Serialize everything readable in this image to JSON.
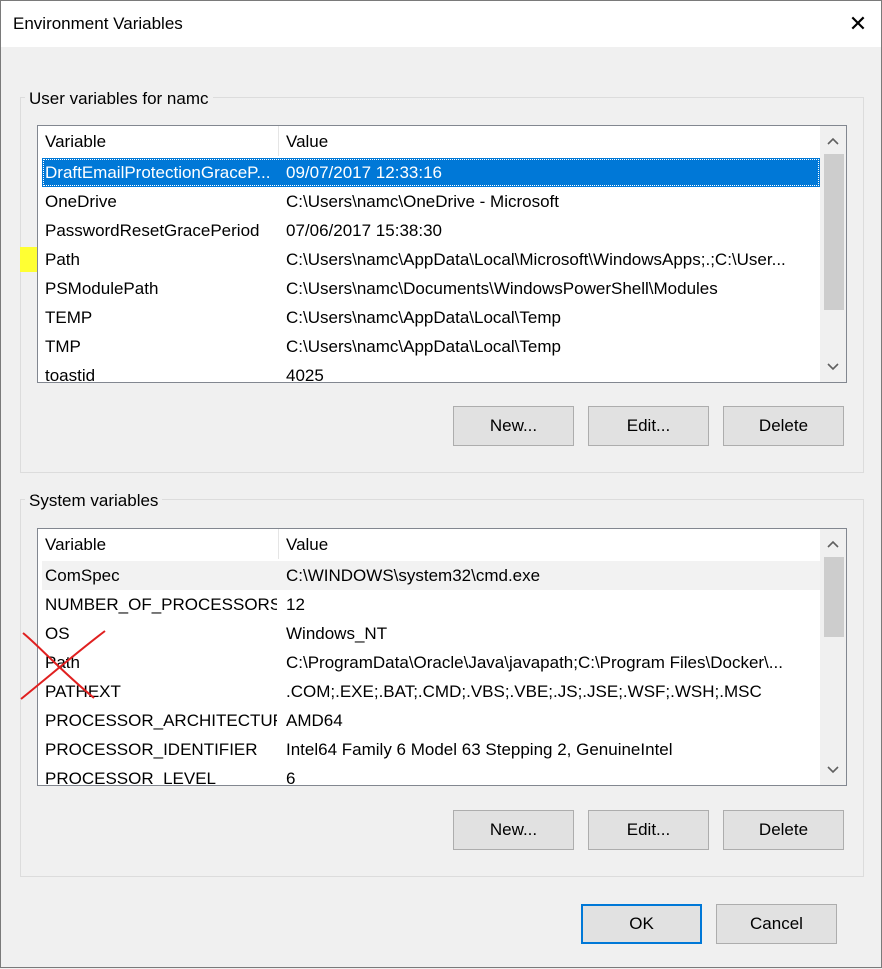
{
  "window": {
    "title": "Environment Variables"
  },
  "user_vars": {
    "label": "User variables for namc",
    "columns": [
      "Variable",
      "Value"
    ],
    "rows": [
      {
        "name": "DraftEmailProtectionGraceP...",
        "value": "09/07/2017 12:33:16"
      },
      {
        "name": "OneDrive",
        "value": "C:\\Users\\namc\\OneDrive - Microsoft"
      },
      {
        "name": "PasswordResetGracePeriod",
        "value": "07/06/2017 15:38:30"
      },
      {
        "name": "Path",
        "value": "C:\\Users\\namc\\AppData\\Local\\Microsoft\\WindowsApps;.;C:\\User..."
      },
      {
        "name": "PSModulePath",
        "value": "C:\\Users\\namc\\Documents\\WindowsPowerShell\\Modules"
      },
      {
        "name": "TEMP",
        "value": "C:\\Users\\namc\\AppData\\Local\\Temp"
      },
      {
        "name": "TMP",
        "value": "C:\\Users\\namc\\AppData\\Local\\Temp"
      },
      {
        "name": "toastid",
        "value": "4025"
      }
    ],
    "buttons": {
      "new": "New...",
      "edit": "Edit...",
      "delete": "Delete"
    }
  },
  "system_vars": {
    "label": "System variables",
    "columns": [
      "Variable",
      "Value"
    ],
    "rows": [
      {
        "name": "ComSpec",
        "value": "C:\\WINDOWS\\system32\\cmd.exe"
      },
      {
        "name": "NUMBER_OF_PROCESSORS",
        "value": "12"
      },
      {
        "name": "OS",
        "value": "Windows_NT"
      },
      {
        "name": "Path",
        "value": "C:\\ProgramData\\Oracle\\Java\\javapath;C:\\Program Files\\Docker\\..."
      },
      {
        "name": "PATHEXT",
        "value": ".COM;.EXE;.BAT;.CMD;.VBS;.VBE;.JS;.JSE;.WSF;.WSH;.MSC"
      },
      {
        "name": "PROCESSOR_ARCHITECTURE",
        "value": "AMD64"
      },
      {
        "name": "PROCESSOR_IDENTIFIER",
        "value": "Intel64 Family 6 Model 63 Stepping 2, GenuineIntel"
      },
      {
        "name": "PROCESSOR_LEVEL",
        "value": "6"
      }
    ],
    "buttons": {
      "new": "New...",
      "edit": "Edit...",
      "delete": "Delete"
    }
  },
  "footer": {
    "ok": "OK",
    "cancel": "Cancel"
  },
  "colors": {
    "selection": "#0078d7",
    "highlight": "#ffff33",
    "annotation": "#e02020"
  }
}
